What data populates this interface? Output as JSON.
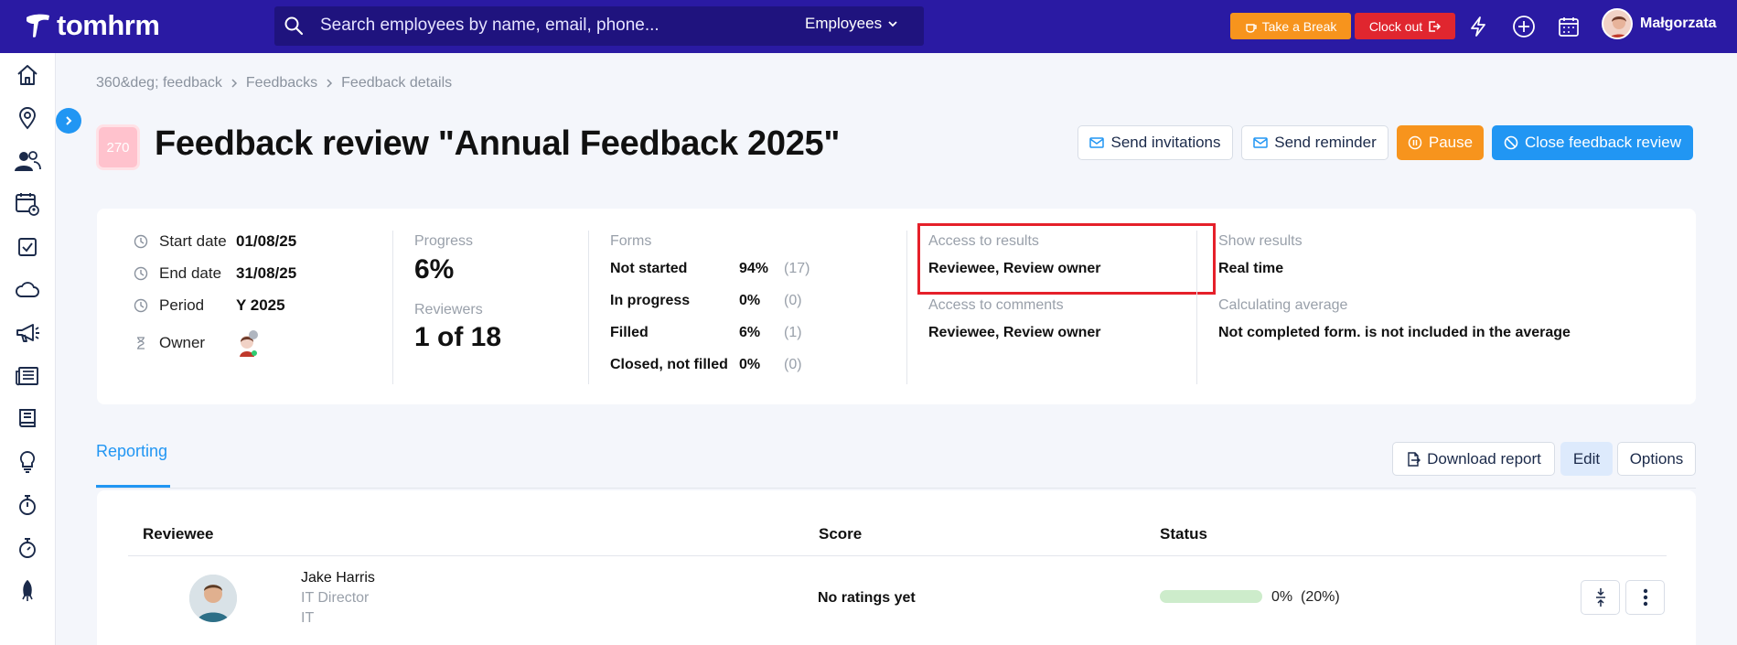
{
  "app": {
    "logo_text": "tomhrm",
    "search_placeholder": "Search employees by name, email, phone...",
    "search_scope": "Employees",
    "take_break_label": "Take a Break",
    "clock_out_label": "Clock out",
    "user_name": "Małgorzata"
  },
  "sidebar": {
    "items": [
      {
        "icon": "home-icon"
      },
      {
        "icon": "location-pin-icon"
      },
      {
        "icon": "people-icon"
      },
      {
        "icon": "calendar-user-icon"
      },
      {
        "icon": "checkbox-icon"
      },
      {
        "icon": "cloud-icon"
      },
      {
        "icon": "megaphone-icon"
      },
      {
        "icon": "newspaper-icon"
      },
      {
        "icon": "book-icon"
      },
      {
        "icon": "lightbulb-icon"
      },
      {
        "icon": "stopwatch-icon"
      },
      {
        "icon": "timer-icon"
      },
      {
        "icon": "rocket-icon"
      }
    ]
  },
  "breadcrumb": [
    "360&deg; feedback",
    "Feedbacks",
    "Feedback details"
  ],
  "header": {
    "id_badge": "270",
    "title": "Feedback review \"Annual Feedback 2025\"",
    "send_invitations": "Send invitations",
    "send_reminder": "Send reminder",
    "pause": "Pause",
    "close_review": "Close feedback review"
  },
  "summary": {
    "start_date_label": "Start date",
    "start_date": "01/08/25",
    "end_date_label": "End date",
    "end_date": "31/08/25",
    "period_label": "Period",
    "period": "Y 2025",
    "owner_label": "Owner",
    "progress_label": "Progress",
    "progress_value": "6%",
    "reviewers_label": "Reviewers",
    "reviewers_value": "1 of 18",
    "forms_label": "Forms",
    "forms": [
      {
        "label": "Not started",
        "percent": "94%",
        "count": "(17)"
      },
      {
        "label": "In progress",
        "percent": "0%",
        "count": "(0)"
      },
      {
        "label": "Filled",
        "percent": "6%",
        "count": "(1)"
      },
      {
        "label": "Closed, not filled",
        "percent": "0%",
        "count": "(0)"
      }
    ],
    "access_results_label": "Access to results",
    "access_results_value": "Reviewee, Review owner",
    "access_comments_label": "Access to comments",
    "access_comments_value": "Reviewee, Review owner",
    "show_results_label": "Show results",
    "show_results_value": "Real time",
    "calc_avg_label": "Calculating average",
    "calc_avg_value": "Not completed form. is not included in the average"
  },
  "reporting": {
    "tab_label": "Reporting",
    "download_report": "Download report",
    "edit": "Edit",
    "options": "Options",
    "columns": [
      "Reviewee",
      "Score",
      "Status"
    ],
    "rows": [
      {
        "name": "Jake Harris",
        "title": "IT Director",
        "department": "IT",
        "score": "No ratings yet",
        "progress_fraction": 0.0,
        "progress_text": "0%",
        "progress_extra": "(20%)"
      }
    ]
  },
  "colors": {
    "topbar": "#2a1aa3",
    "accent_blue": "#2196f3",
    "orange": "#f7941d",
    "red": "#e0262f",
    "highlight": "#e5202a"
  }
}
